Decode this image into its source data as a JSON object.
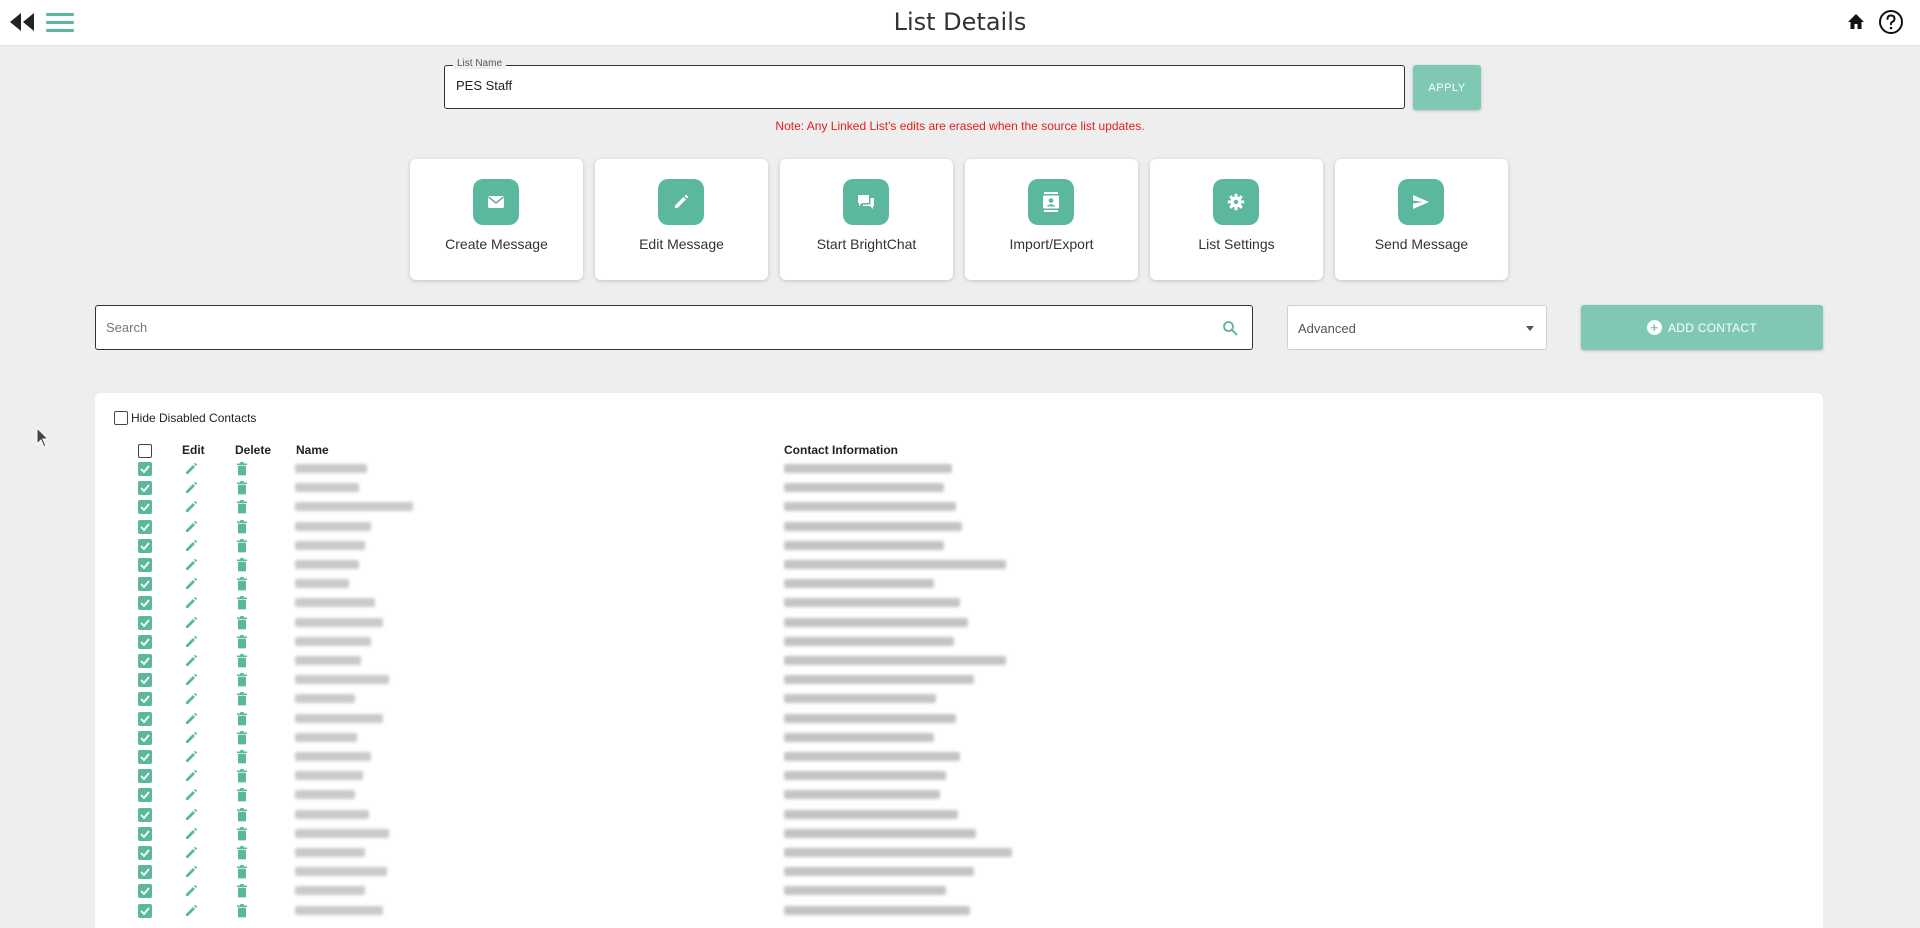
{
  "header": {
    "title": "List Details"
  },
  "list_name": {
    "label": "List Name",
    "value": "PES Staff",
    "apply_label": "APPLY"
  },
  "note": "Note: Any Linked List's edits are erased when the source list updates.",
  "actions": [
    {
      "label": "Create Message",
      "icon": "mail-icon"
    },
    {
      "label": "Edit Message",
      "icon": "pencil-icon"
    },
    {
      "label": "Start BrightChat",
      "icon": "chat-icon"
    },
    {
      "label": "Import/Export",
      "icon": "contact-card-icon"
    },
    {
      "label": "List Settings",
      "icon": "gear-icon"
    },
    {
      "label": "Send Message",
      "icon": "send-icon"
    }
  ],
  "search": {
    "placeholder": "Search"
  },
  "filter": {
    "selected": "Advanced"
  },
  "add_contact_label": "ADD CONTACT",
  "table": {
    "hide_disabled_label": "Hide Disabled Contacts",
    "columns": {
      "edit": "Edit",
      "delete": "Delete",
      "name": "Name",
      "contact": "Contact Information"
    },
    "row_count_visible": 24
  },
  "colors": {
    "accent": "#5bb89e",
    "accent_light": "#7ec8b4",
    "note": "#e02020"
  }
}
